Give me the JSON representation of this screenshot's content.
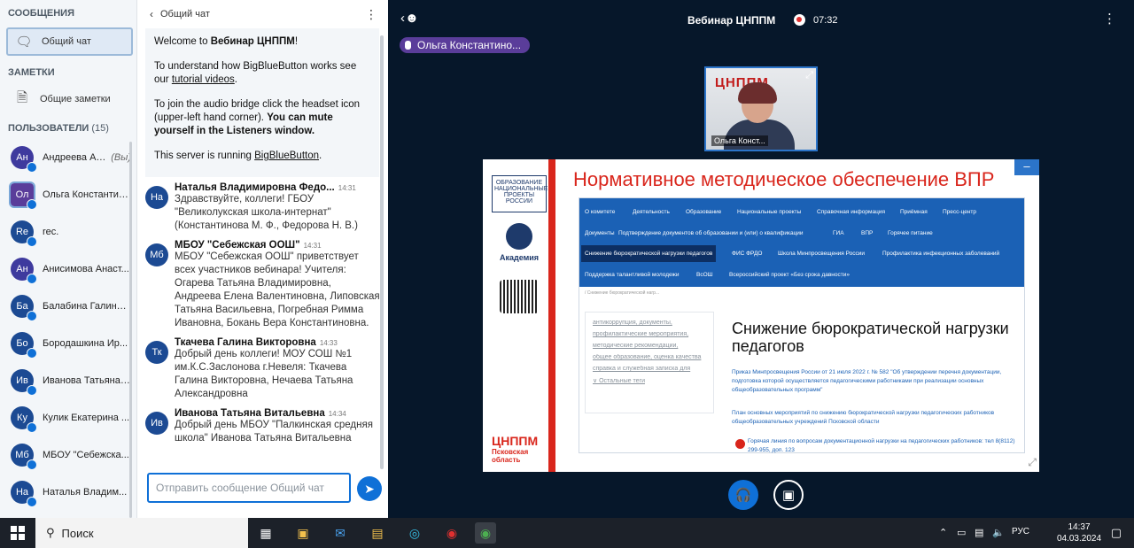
{
  "sidebar": {
    "messages_title": "СООБЩЕНИЯ",
    "public_chat": "Общий чат",
    "notes_title": "ЗАМЕТКИ",
    "shared_notes": "Общие заметки",
    "users_title": "ПОЛЬЗОВАТЕЛИ",
    "users_count": "(15)",
    "users": [
      {
        "initials": "Ан",
        "name": "Андреева Ал...",
        "you": "(Вы)",
        "color": "#3e3a9e"
      },
      {
        "initials": "Ол",
        "name": "Ольга Константин...",
        "you": "",
        "color": "#5a3d9a"
      },
      {
        "initials": "Re",
        "name": "rec.",
        "you": "",
        "color": "#1c4a93"
      },
      {
        "initials": "Ан",
        "name": "Анисимова Анаст...",
        "you": "",
        "color": "#3e3a9e"
      },
      {
        "initials": "Ба",
        "name": "Балабина Галина ...",
        "you": "",
        "color": "#1c4a93"
      },
      {
        "initials": "Бо",
        "name": "Бородашкина Ир...",
        "you": "",
        "color": "#1c4a93"
      },
      {
        "initials": "Ив",
        "name": "Иванова Татьяна ...",
        "you": "",
        "color": "#1c4a93"
      },
      {
        "initials": "Ку",
        "name": "Кулик Екатерина ...",
        "you": "",
        "color": "#1c4a93"
      },
      {
        "initials": "Мб",
        "name": "МБОУ \"Себежска...",
        "you": "",
        "color": "#1c4a93"
      },
      {
        "initials": "На",
        "name": "Наталья Владим...",
        "you": "",
        "color": "#1c4a93"
      }
    ]
  },
  "chat": {
    "header": "Общий чат",
    "welcome_prefix": "Welcome to ",
    "welcome_name": "Вебинар ЦНППМ",
    "welcome_suffix": "!",
    "p2_text": "To understand how BigBlueButton works see our ",
    "p2_link": "tutorial videos",
    "p2_end": ".",
    "p3_text": "To join the audio bridge click the headset icon (upper-left hand corner). ",
    "p3_bold": "You can mute yourself in the Listeners window.",
    "p4_text": "This server is running ",
    "p4_link": "BigBlueButton",
    "p4_end": ".",
    "messages": [
      {
        "initials": "На",
        "author": "Наталья Владимировна Федо...",
        "time": "14:31",
        "text": "Здравствуйте, коллеги! ГБОУ \"Великолукская школа-интернат\" (Константинова М. Ф., Федорова Н. В.)"
      },
      {
        "initials": "Мб",
        "author": "МБОУ \"Себежская ООШ\"",
        "time": "14:31",
        "text": "МБОУ \"Себежская ООШ\" приветствует всех участников вебинара! Учителя: Огарева Татьяна Владимировна, Андреева Елена Валентиновна, Липовская Татьяна Васильевна, Погребная Римма Ивановна, Бокань Вера Константиновна."
      },
      {
        "initials": "Тк",
        "author": "Ткачева Галина Викторовна",
        "time": "14:33",
        "text": "Добрый день коллеги! МОУ СОШ №1 им.К.С.Заслонова г.Невеля: Ткачева Галина Викторовна, Нечаева Татьяна Александровна"
      },
      {
        "initials": "Ив",
        "author": "Иванова Татьяна Витальевна",
        "time": "14:34",
        "text": "Добрый день МБОУ \"Палкинская средняя школа\" Иванова Татьяна Витальевна"
      }
    ],
    "input_placeholder": "Отправить сообщение Общий чат"
  },
  "main": {
    "title": "Вебинар ЦНППМ",
    "rec_time": "07:32",
    "talker": "Ольга Константино...",
    "webcam_name": "Ольга Конст...",
    "webcam_logo": "ЦНППМ"
  },
  "slide": {
    "title": "Нормативное методическое обеспечение ВПР",
    "logo1": "ОБРАЗОВАНИЕ НАЦИОНАЛЬНЫЕ ПРОЕКТЫ РОССИИ",
    "logo2": "Академия",
    "logo4": "ЦНППМ",
    "logo4_sub": "Псковская область",
    "nav": [
      "О комитете",
      "Деятельность",
      "Образование",
      "Национальные проекты",
      "Справочная информация",
      "Приёмная",
      "Пресс-центр",
      "Документы",
      "Подтверждение документов об образовании и (или) о квалификации",
      "ГИА",
      "ВПР",
      "Горячее питание",
      "Снижение бюрократической нагрузки педагогов",
      "ФИС ФРДО",
      "Школа Минпросвещения России",
      "Профилактика инфекционных заболеваний",
      "Поддержка талантливой молодежи",
      "ВсОШ",
      "Всероссийский проект «Без срока давности»"
    ],
    "crumbs": "/ Снижение бюрократической нагр...",
    "tags": [
      "антикоррупция, документы,",
      "профилактические мероприятия,",
      "методические рекомендации,",
      "общее образование, оценка качества",
      "справка и служебная записка для",
      "∨ Остальные теги"
    ],
    "heading": "Снижение бюрократической нагрузки педагогов",
    "link1": "Приказ Минпросвещения России от 21 июля 2022 г. № 582 \"Об утверждении перечня документации, подготовка которой осуществляется педагогическими работниками при реализации основных общеобразовательных программ\"",
    "link2": "План основных мероприятий по снижению бюрократической нагрузки педагогических работников общеобразовательных учреждений Псковской области",
    "hotline": "Горячая линия по вопросам документационной нагрузки на педагогических работников: тел 8(8112) 299-955, доп. 123"
  },
  "taskbar": {
    "search": "Поиск",
    "lang": "РУС",
    "time": "14:37",
    "date": "04.03.2024"
  }
}
